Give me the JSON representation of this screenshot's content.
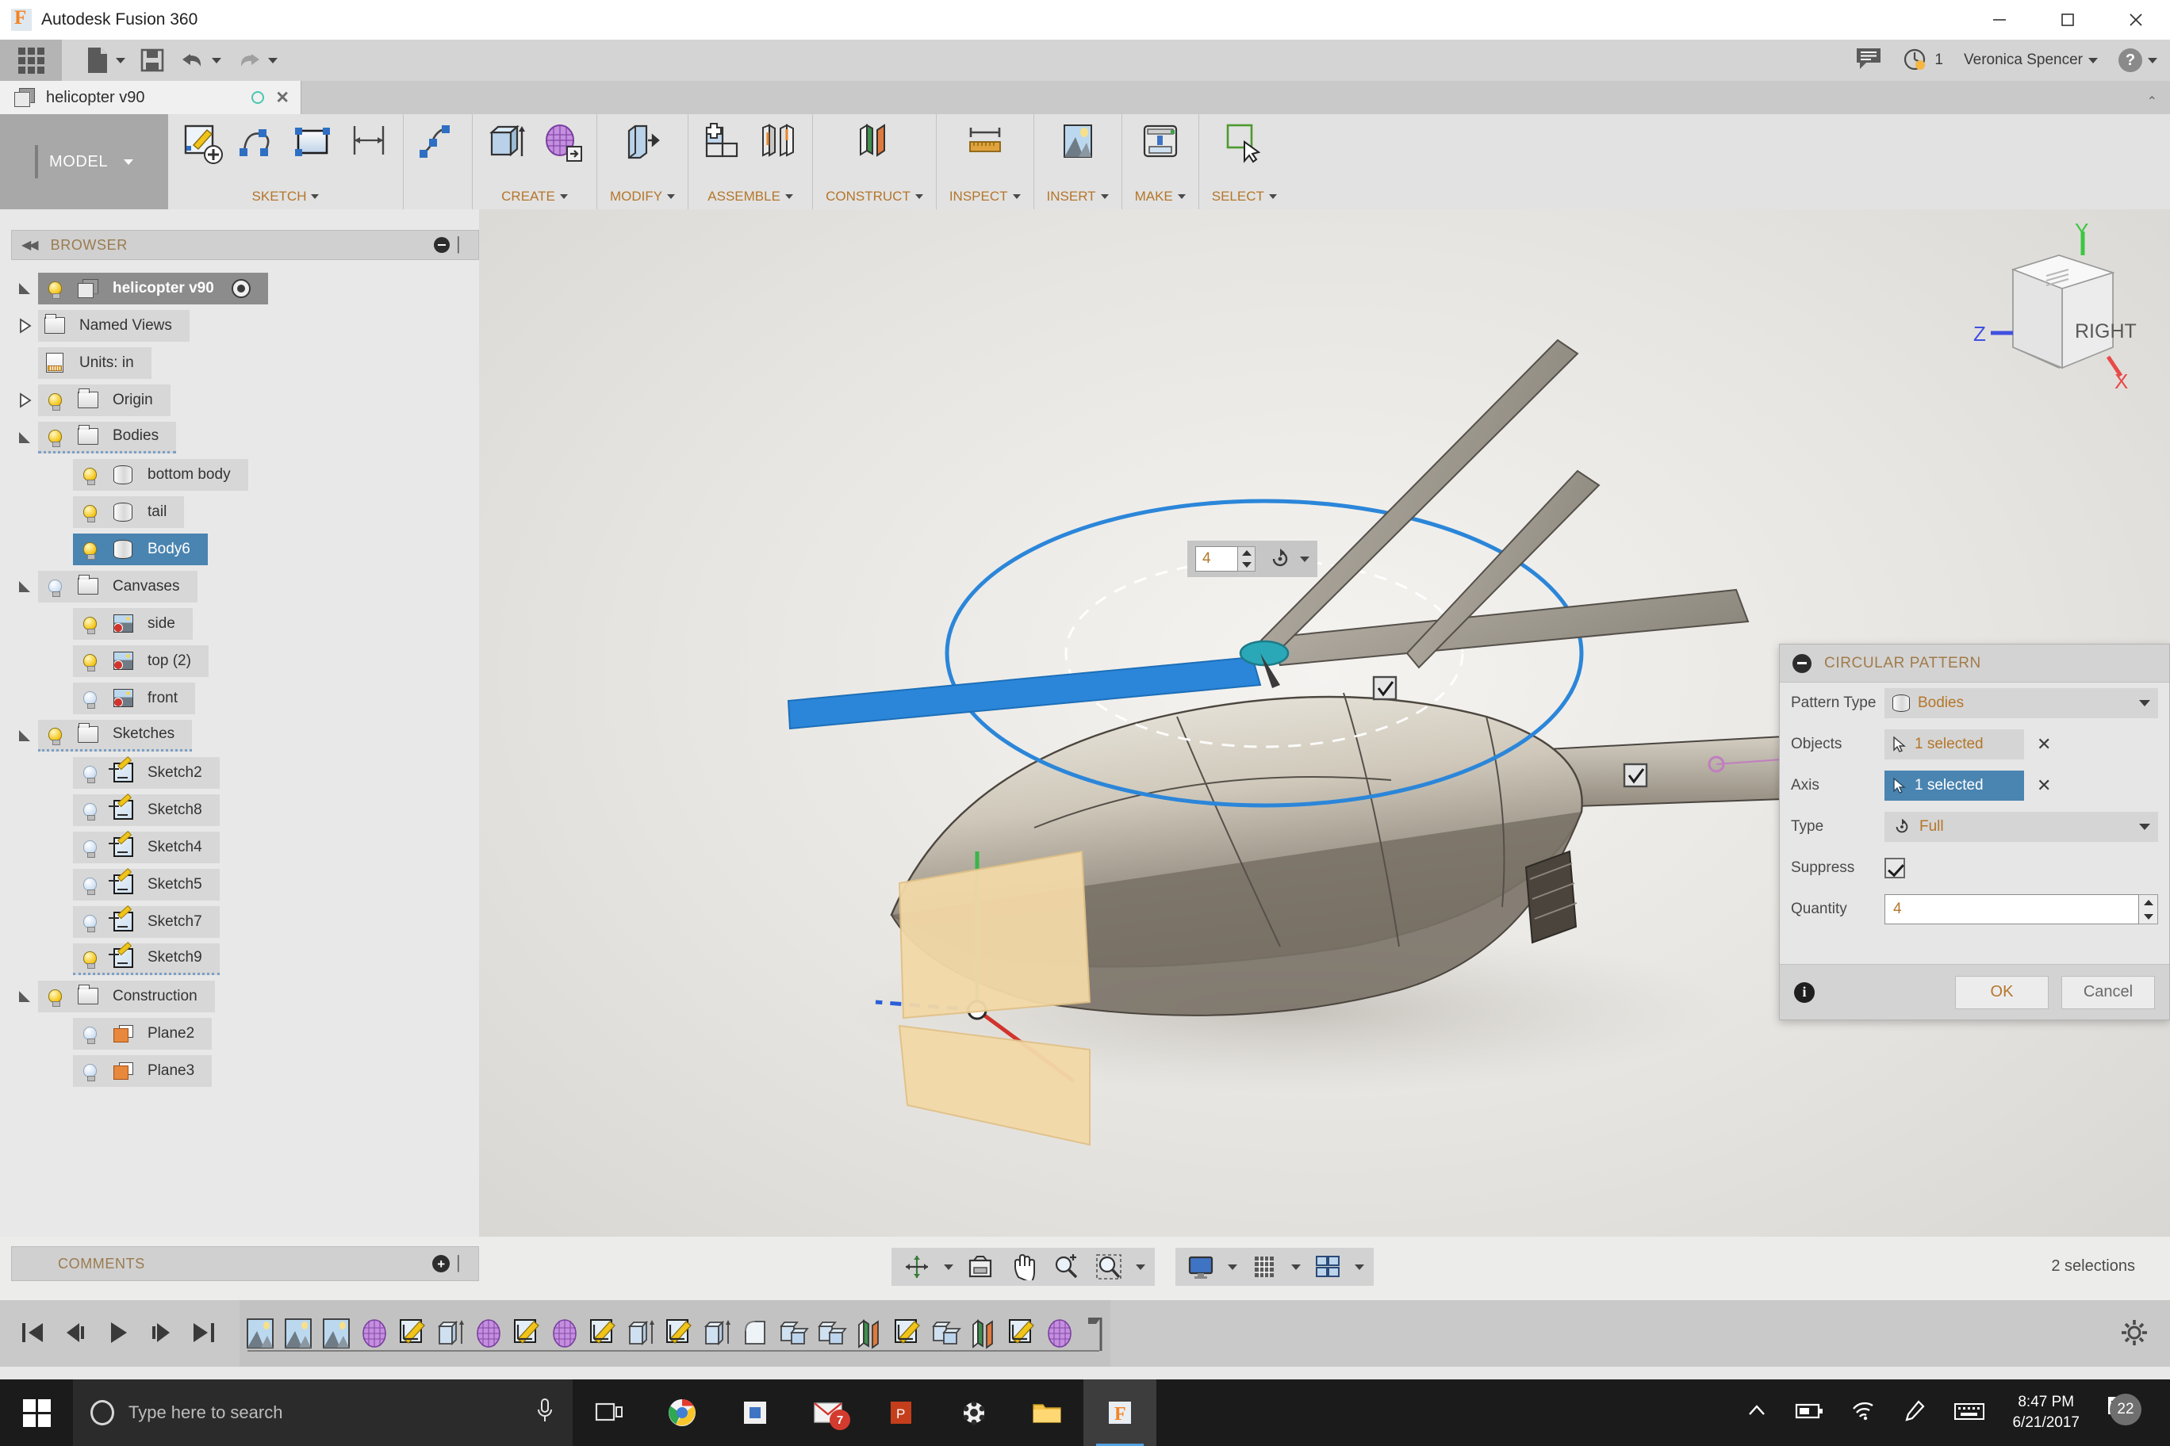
{
  "window": {
    "title": "Autodesk Fusion 360",
    "logo_icon": "fusion-logo-icon",
    "minimize": "–",
    "maximize": "▢",
    "close": "✕"
  },
  "quick_access": {
    "app_grid_icon": "app-grid-icon",
    "items": [
      {
        "name": "new-file",
        "icon": "file-icon",
        "has_caret": true
      },
      {
        "name": "save",
        "icon": "floppy-save-icon",
        "has_caret": false
      },
      {
        "name": "undo",
        "icon": "undo-arrow-icon",
        "has_caret": true
      },
      {
        "name": "redo",
        "icon": "redo-arrow-icon",
        "has_caret": true
      }
    ],
    "comment_icon": "speech-bubble-icon",
    "job_status_icon": "job-clock-icon",
    "job_count": "1",
    "user_name": "Veronica Spencer",
    "help_icon": "question-mark-icon"
  },
  "document_tab": {
    "icon": "cube-icon",
    "label": "helicopter v90",
    "saved_indicator": "save-state-icon",
    "close_icon": "close-icon"
  },
  "ribbon": {
    "workspace_label": "MODEL",
    "groups": [
      {
        "label": "SKETCH",
        "icons": [
          "create-sketch-icon",
          "spline-icon",
          "rectangle-icon",
          "dimension-icon",
          "fit-point-spline-icon"
        ]
      },
      {
        "label": "CREATE",
        "icons": [
          "extrude-icon",
          "form-icon"
        ]
      },
      {
        "label": "MODIFY",
        "icons": [
          "press-pull-icon"
        ]
      },
      {
        "label": "ASSEMBLE",
        "icons": [
          "new-component-icon",
          "joint-icon"
        ]
      },
      {
        "label": "CONSTRUCT",
        "icons": [
          "offset-plane-icon"
        ]
      },
      {
        "label": "INSPECT",
        "icons": [
          "measure-icon"
        ]
      },
      {
        "label": "INSERT",
        "icons": [
          "insert-canvas-icon"
        ]
      },
      {
        "label": "MAKE",
        "icons": [
          "3d-print-icon"
        ]
      },
      {
        "label": "SELECT",
        "icons": [
          "select-cursor-icon"
        ]
      }
    ]
  },
  "browser": {
    "collapse_icon": "collapse-left-icon",
    "title": "BROWSER",
    "root": {
      "label": "helicopter v90",
      "icon": "cube-icon",
      "bulb": "on",
      "selected": true,
      "radio_icon": "active-component-icon"
    },
    "items": [
      {
        "label": "Named Views",
        "icon": "folder-icon",
        "indent": 1,
        "twist": "closed",
        "bulb": "none"
      },
      {
        "label": "Units: in",
        "icon": "document-icon",
        "indent": 1,
        "twist": "none",
        "bulb": "none"
      },
      {
        "label": "Origin",
        "icon": "folder-icon",
        "indent": 1,
        "twist": "closed",
        "bulb": "on"
      },
      {
        "label": "Bodies",
        "icon": "folder-icon",
        "indent": 1,
        "twist": "open",
        "bulb": "on",
        "squiggle": true
      },
      {
        "label": "bottom body",
        "icon": "body-icon",
        "indent": 2,
        "twist": "none",
        "bulb": "on"
      },
      {
        "label": "tail",
        "icon": "body-icon",
        "indent": 2,
        "twist": "none",
        "bulb": "on"
      },
      {
        "label": "Body6",
        "icon": "body-icon",
        "indent": 2,
        "twist": "none",
        "bulb": "on",
        "highlighted": true
      },
      {
        "label": "Canvases",
        "icon": "folder-icon",
        "indent": 1,
        "twist": "open",
        "bulb": "off"
      },
      {
        "label": "side",
        "icon": "canvas-image-icon",
        "indent": 2,
        "twist": "none",
        "bulb": "on"
      },
      {
        "label": "top (2)",
        "icon": "canvas-image-icon",
        "indent": 2,
        "twist": "none",
        "bulb": "on"
      },
      {
        "label": "front",
        "icon": "canvas-image-icon",
        "indent": 2,
        "twist": "none",
        "bulb": "off"
      },
      {
        "label": "Sketches",
        "icon": "folder-icon",
        "indent": 1,
        "twist": "open",
        "bulb": "on",
        "squiggle": true
      },
      {
        "label": "Sketch2",
        "icon": "sketch-icon",
        "indent": 2,
        "twist": "none",
        "bulb": "off"
      },
      {
        "label": "Sketch8",
        "icon": "sketch-icon",
        "indent": 2,
        "twist": "none",
        "bulb": "off"
      },
      {
        "label": "Sketch4",
        "icon": "sketch-icon",
        "indent": 2,
        "twist": "none",
        "bulb": "off"
      },
      {
        "label": "Sketch5",
        "icon": "sketch-icon",
        "indent": 2,
        "twist": "none",
        "bulb": "off"
      },
      {
        "label": "Sketch7",
        "icon": "sketch-icon",
        "indent": 2,
        "twist": "none",
        "bulb": "off"
      },
      {
        "label": "Sketch9",
        "icon": "sketch-icon",
        "indent": 2,
        "twist": "none",
        "bulb": "on",
        "squiggle": true
      },
      {
        "label": "Construction",
        "icon": "folder-icon",
        "indent": 1,
        "twist": "open",
        "bulb": "on"
      },
      {
        "label": "Plane2",
        "icon": "plane-icon",
        "indent": 2,
        "twist": "none",
        "bulb": "off"
      },
      {
        "label": "Plane3",
        "icon": "plane-icon",
        "indent": 2,
        "twist": "none",
        "bulb": "off"
      }
    ]
  },
  "viewcube": {
    "face_label": "RIGHT",
    "axis_x": "X",
    "axis_y": "Y",
    "axis_z": "Z"
  },
  "canvas_manipulator": {
    "quantity_value": "4",
    "type_icon": "rotate-full-icon",
    "step_up_icon": "stepper-up-icon",
    "step_down_icon": "stepper-down-icon",
    "body_checkbox_1": "checked",
    "body_checkbox_2": "checked"
  },
  "circular_pattern_dialog": {
    "collapse_icon": "minus-circle-icon",
    "title": "CIRCULAR PATTERN",
    "rows": [
      {
        "label": "Pattern Type",
        "value": "Bodies",
        "icon": "body-icon",
        "control": "dropdown"
      },
      {
        "label": "Objects",
        "value": "1 selected",
        "icon": "select-cursor-icon",
        "control": "selection",
        "clear": "✕"
      },
      {
        "label": "Axis",
        "value": "1 selected",
        "icon": "select-cursor-icon",
        "control": "selection",
        "active": true,
        "clear": "✕"
      },
      {
        "label": "Type",
        "value": "Full",
        "icon": "rotate-full-icon",
        "control": "dropdown"
      },
      {
        "label": "Suppress",
        "value": "",
        "control": "checkbox",
        "checked": true
      },
      {
        "label": "Quantity",
        "value": "4",
        "control": "number"
      }
    ],
    "info_icon": "info-icon",
    "ok_label": "OK",
    "cancel_label": "Cancel"
  },
  "status_bar": {
    "comments_label": "COMMENTS",
    "comments_add_icon": "add-comment-icon",
    "nav_tools": [
      {
        "name": "orbit-icon",
        "caret": true
      },
      {
        "name": "look-at-icon",
        "caret": false
      },
      {
        "name": "pan-icon",
        "caret": false
      },
      {
        "name": "zoom-icon",
        "caret": false
      },
      {
        "name": "fit-icon",
        "caret": true
      }
    ],
    "display_tools": [
      {
        "name": "display-settings-icon",
        "caret": true
      },
      {
        "name": "grid-snaps-icon",
        "caret": true
      },
      {
        "name": "viewports-icon",
        "caret": true
      }
    ],
    "selection_text": "2 selections"
  },
  "timeline": {
    "playback": [
      "go-to-beginning-icon",
      "step-back-icon",
      "play-icon",
      "step-forward-icon",
      "go-to-end-icon"
    ],
    "features": [
      "canvas-icon",
      "canvas-icon",
      "canvas-icon",
      "form-icon",
      "sketch-icon",
      "extrude-icon",
      "form-icon",
      "sketch-icon",
      "form-icon",
      "sketch-icon",
      "extrude-icon",
      "sketch-icon",
      "extrude-icon",
      "fillet-icon",
      "combine-icon",
      "combine-icon",
      "plane-icon",
      "sketch-icon",
      "combine-icon",
      "plane-icon",
      "sketch-icon",
      "form-icon"
    ],
    "end_marker_icon": "timeline-end-marker-icon",
    "settings_icon": "gear-icon"
  },
  "taskbar": {
    "start_icon": "windows-start-icon",
    "search_placeholder": "Type here to search",
    "cortana_icon": "cortana-circle-icon",
    "mic_icon": "microphone-icon",
    "apps": [
      {
        "name": "task-view-icon",
        "badge": ""
      },
      {
        "name": "chrome-icon",
        "badge": ""
      },
      {
        "name": "store-icon",
        "badge": ""
      },
      {
        "name": "mail-icon",
        "badge": "7"
      },
      {
        "name": "powerpoint-icon",
        "badge": ""
      },
      {
        "name": "settings-app-icon",
        "badge": ""
      },
      {
        "name": "file-explorer-icon",
        "badge": ""
      },
      {
        "name": "fusion360-taskbar-icon",
        "badge": ""
      }
    ],
    "tray": [
      "show-hidden-icons-icon",
      "battery-icon",
      "wifi-icon",
      "pen-icon",
      "keyboard-icon"
    ],
    "time": "8:47 PM",
    "date": "6/21/2017",
    "notification_icon": "action-center-icon",
    "notification_count": "22"
  },
  "colors": {
    "accent_orange": "#b4762a",
    "selection_blue": "#4a84b0",
    "ribbon_bg": "#e2e2e2",
    "taskbar_bg": "#1b1b1b"
  }
}
